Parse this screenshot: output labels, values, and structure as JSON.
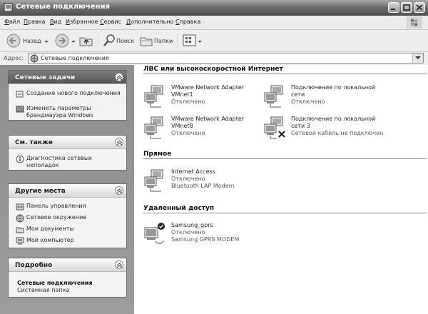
{
  "window": {
    "title": "Сетевые подключения",
    "buttons": [
      "minimize",
      "maximize",
      "close"
    ]
  },
  "menu": {
    "items": [
      "Файл",
      "Правка",
      "Вид",
      "Избранное",
      "Сервис",
      "Дополнительно",
      "Справка"
    ]
  },
  "toolbar": {
    "back_label": "Назад",
    "search_label": "Поиск",
    "folders_label": "Папки"
  },
  "address": {
    "label": "Адрес:",
    "value": "Сетевые подключения"
  },
  "left_panel": {
    "network_tasks": {
      "title": "Сетевые задачи",
      "items": [
        {
          "label": "Создание нового подключения",
          "icon": "new-connection-icon"
        },
        {
          "label": "Изменить параметры брандмауэра Windows",
          "icon": "firewall-icon"
        }
      ]
    },
    "see_also": {
      "title": "См. также",
      "items": [
        {
          "label": "Диагностика сетевых неполадок",
          "icon": "info-icon"
        }
      ]
    },
    "other_places": {
      "title": "Другие места",
      "items": [
        {
          "label": "Панель управления",
          "icon": "control-panel-icon"
        },
        {
          "label": "Сетевое окружение",
          "icon": "network-places-icon"
        },
        {
          "label": "Мои документы",
          "icon": "my-documents-icon"
        },
        {
          "label": "Мой компьютер",
          "icon": "my-computer-icon"
        }
      ]
    },
    "details": {
      "title": "Подробно",
      "name": "Сетевые подключения",
      "type": "Системная папка"
    }
  },
  "content": {
    "groups": [
      {
        "title": "ЛВС или высокоскоростной Интернет",
        "connections": [
          {
            "line1": "VMware Network Adapter",
            "line2": "VMnet1",
            "status": "Отключено"
          },
          {
            "line1": "Подключение по локальной",
            "line2": "сети",
            "status": "Отключено"
          },
          {
            "line1": "VMware Network Adapter",
            "line2": "VMnet8",
            "status": "Отключено"
          },
          {
            "line1": "Подключение по локальной",
            "line2": "сети 3",
            "status": "Сетевой кабель не подключен"
          }
        ]
      },
      {
        "title": "Прямое",
        "connections": [
          {
            "line1": "Internet Access",
            "line2": "Отключено",
            "status": "Bluetooth LAP Modem"
          }
        ]
      },
      {
        "title": "Удаленный доступ",
        "connections": [
          {
            "line1": "Samsung_gprs",
            "line2": "Отключено",
            "status": "Samsung GPRS MODEM"
          }
        ]
      }
    ]
  }
}
